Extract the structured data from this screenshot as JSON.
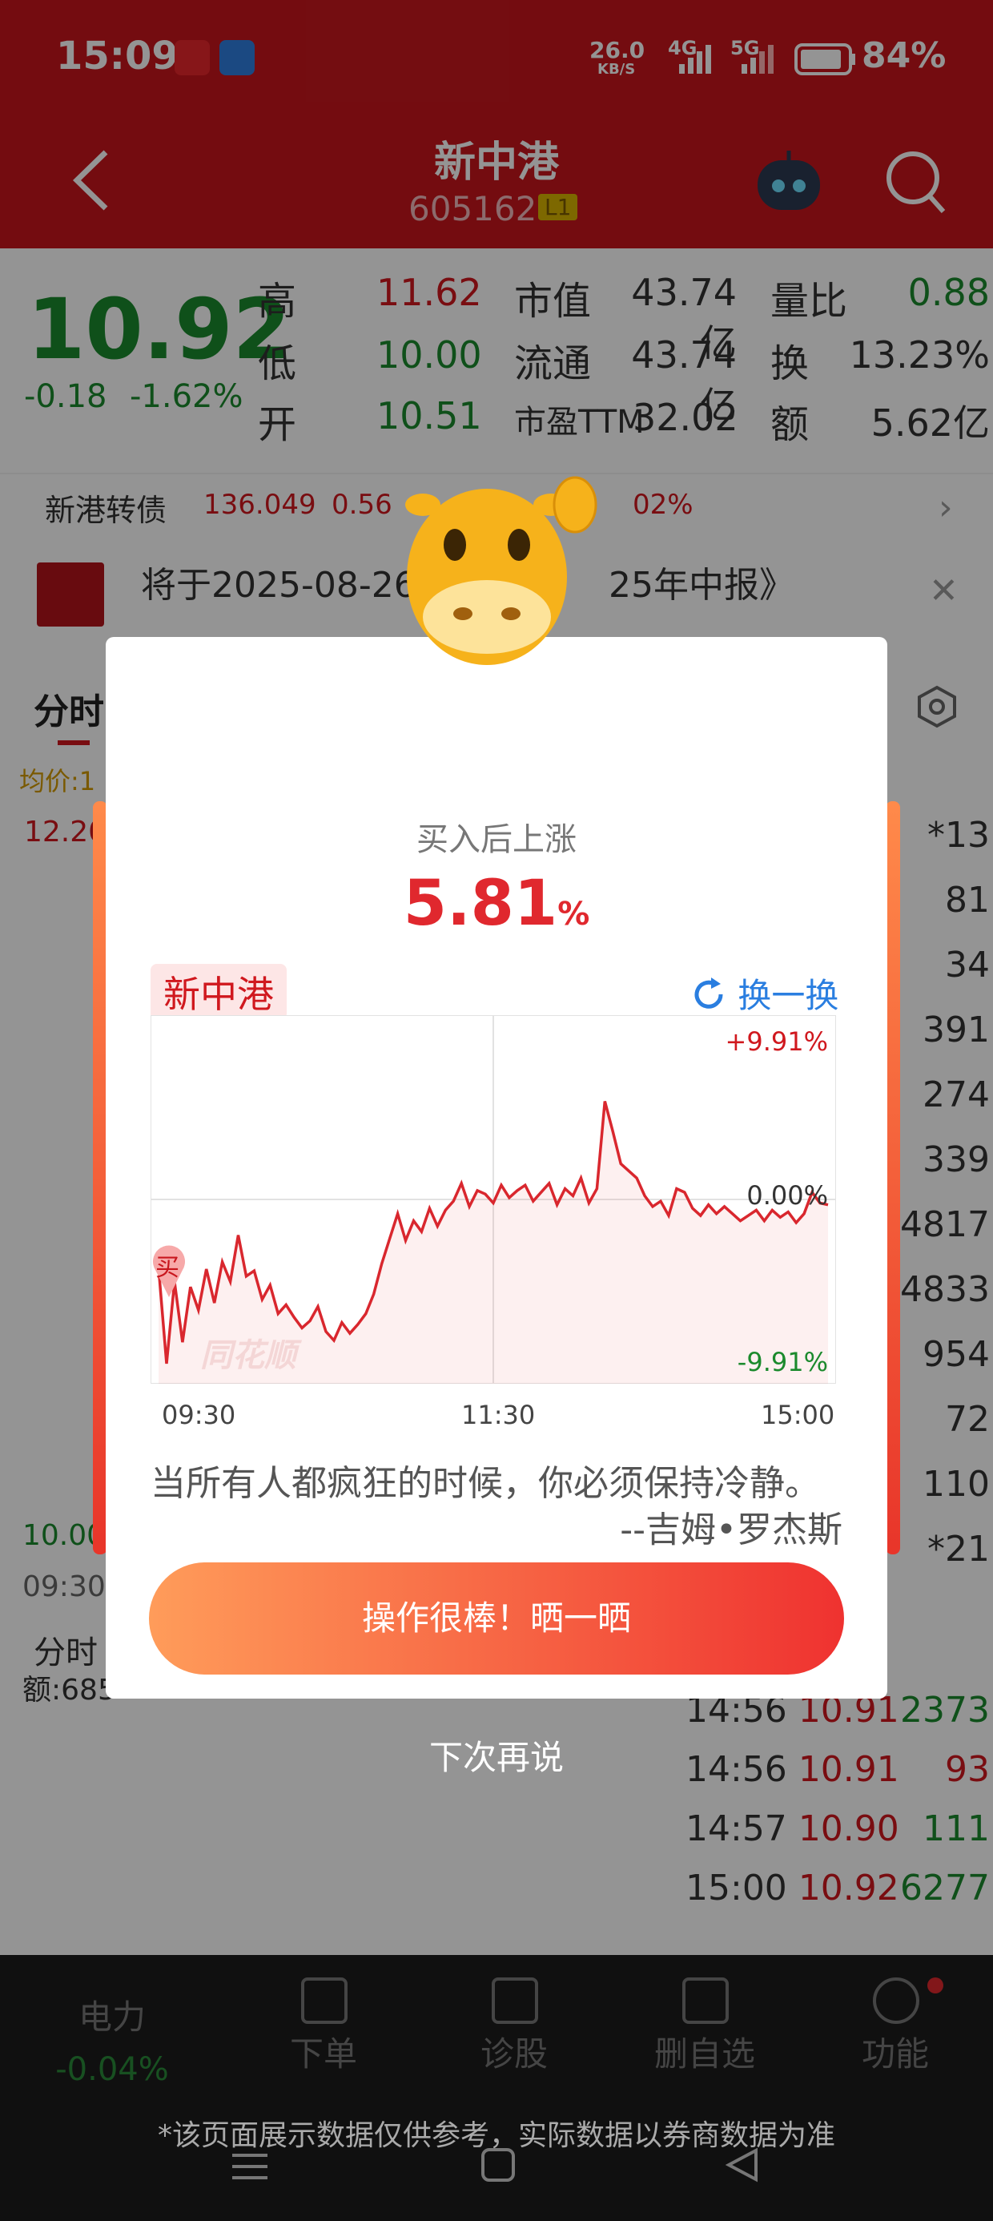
{
  "status": {
    "time": "15:09",
    "net_speed": "26.0",
    "net_unit": "KB/S",
    "sig1": "4G",
    "sig2": "5G",
    "battery": "84%"
  },
  "header": {
    "title": "新中港",
    "code": "605162",
    "badge": "L1"
  },
  "quote": {
    "price": "10.92",
    "change": "-0.18",
    "change_pct": "-1.62%",
    "high_label": "高",
    "high": "11.62",
    "low_label": "低",
    "low": "10.00",
    "open_label": "开",
    "open": "10.51",
    "mktcap_label": "市值",
    "mktcap": "43.74亿",
    "float_label": "流通",
    "float": "43.74亿",
    "pe_label": "市盈TTM",
    "pe": "32.02",
    "vr_label": "量比",
    "vr": "0.88",
    "turn_label": "换",
    "turn": "13.23%",
    "amt_label": "额",
    "amt": "5.62亿"
  },
  "bond": {
    "name": "新港转债",
    "price": "136.049",
    "chg": "0.56",
    "pct": "02%"
  },
  "notice": {
    "text": "将于2025-08-26",
    "text2": "25年中报》"
  },
  "tabs": {
    "fenshi": "分时",
    "avg": "均价:1"
  },
  "left_axis": {
    "top": "12.20",
    "bottom": "10.00",
    "time": "09:30",
    "subtitle": "分时",
    "vol": "额:685"
  },
  "right_col": [
    "*13",
    "81",
    "34",
    "391",
    "274",
    "339",
    "4817",
    "4833",
    "954",
    "72",
    "110",
    "*21"
  ],
  "trades": [
    {
      "t": "14:56",
      "p": "10.91",
      "v": "2373"
    },
    {
      "t": "14:56",
      "p": "10.91",
      "v": "93"
    },
    {
      "t": "14:57",
      "p": "10.90",
      "v": "111"
    },
    {
      "t": "15:00",
      "p": "10.92",
      "v": "6277"
    }
  ],
  "dialog": {
    "title": "买入后上涨",
    "pct": "5.81",
    "pct_unit": "%",
    "stock": "新中港",
    "refresh": "换一换",
    "buy_tag": "买",
    "watermark": "同花顺",
    "quote": "当所有人都疯狂的时候，你必须保持冷静。",
    "author": "--吉姆•罗杰斯",
    "share_button": "操作很棒！晒一晒",
    "later": "下次再说"
  },
  "chart_data": {
    "type": "line",
    "x_ticks": [
      "09:30",
      "11:30",
      "15:00"
    ],
    "y_labels": {
      "top": "+9.91%",
      "mid": "0.00%",
      "bottom": "-9.91%"
    },
    "ylim": [
      -9.91,
      9.91
    ],
    "series": [
      {
        "values": [
          -3.8,
          -9.2,
          -4.6,
          -8.0,
          -4.9,
          -6.2,
          -3.9,
          -5.8,
          -3.5,
          -4.6,
          -2.0,
          -4.3,
          -4.0,
          -5.6,
          -4.8,
          -6.4,
          -5.9,
          -6.6,
          -7.2,
          -6.8,
          -6.0,
          -7.4,
          -7.9,
          -6.9,
          -7.5,
          -7.0,
          -6.4,
          -5.3,
          -3.6,
          -2.2,
          -0.8,
          -2.3,
          -1.2,
          -1.8,
          -0.5,
          -1.5,
          -0.6,
          -0.1,
          0.9,
          -0.4,
          0.5,
          0.3,
          -0.2,
          0.8,
          0.1,
          0.5,
          0.8,
          -0.1,
          0.4,
          0.9,
          -0.3,
          0.6,
          0.2,
          1.2,
          -0.2,
          0.6,
          5.5,
          3.8,
          2.0,
          1.6,
          1.2,
          0.2,
          -0.4,
          -0.1,
          -0.9,
          0.6,
          0.4,
          -0.5,
          -0.9,
          -0.3,
          -0.8,
          -0.4,
          -0.8,
          -1.2,
          -0.9,
          -0.6,
          -1.2,
          -0.6,
          -1.0,
          -0.7,
          -1.3,
          -0.8,
          0.4,
          -0.2,
          -0.3
        ]
      }
    ]
  },
  "nav": {
    "item1": "电力",
    "item1_val": "-0.04%",
    "item2": "下单",
    "item3": "诊股",
    "item4": "删自选",
    "item5": "功能"
  },
  "disclaimer": "*该页面展示数据仅供参考，实际数据以券商数据为准"
}
